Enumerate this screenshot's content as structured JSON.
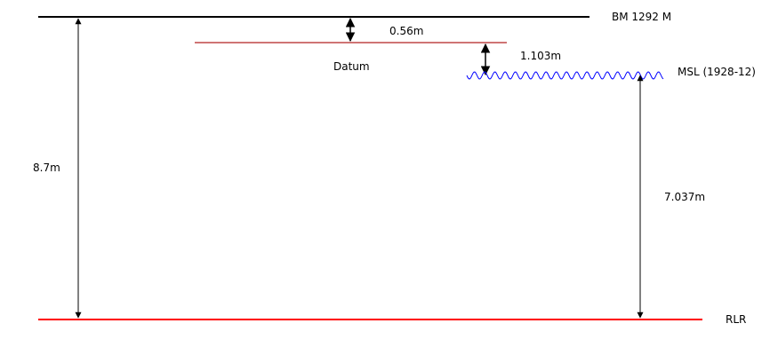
{
  "labels": {
    "bm": "BM 1292 M",
    "datum": "Datum",
    "msl": "MSL (1928-12)",
    "rlr": "RLR",
    "bm_to_datum": "0.56m",
    "datum_to_msl": "1.103m",
    "bm_to_rlr": "8.7m",
    "msl_to_rlr": "7.037m"
  },
  "colors": {
    "bm_line": "#000000",
    "datum_line": "#b22222",
    "msl_wave": "#0000ff",
    "rlr_line": "#ff0000",
    "arrows": "#000000"
  }
}
